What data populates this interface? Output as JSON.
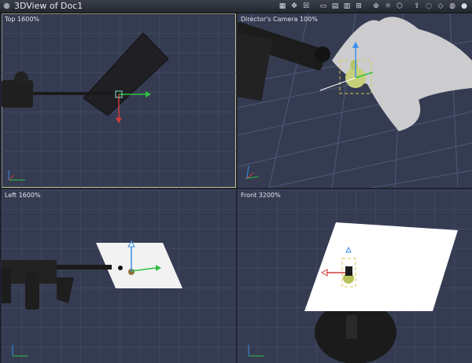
{
  "window": {
    "title": "3DView of Doc1"
  },
  "toolbar": {
    "icons": [
      "grid-icon",
      "camera-fit-icon",
      "wireframe-icon",
      "layout-1-icon",
      "layout-2-icon",
      "layout-3-icon",
      "layout-4-icon",
      "gizmo-icon",
      "light-icon",
      "bounding-box-icon",
      "axis-icon",
      "sphere-icon",
      "cube-icon",
      "shade-icon",
      "material-icon"
    ]
  },
  "viewports": {
    "top": {
      "label": "Top 1600%"
    },
    "camera": {
      "label": "Director's Camera 100%"
    },
    "left": {
      "label": "Left 1600%"
    },
    "front": {
      "label": "Front 3200%"
    }
  },
  "colors": {
    "viewport_bg": "#353c52",
    "grid_line": "#4a5270",
    "active_border": "#c9c28a",
    "axis_x": "#d23b3b",
    "axis_y": "#2fbf3f",
    "axis_z": "#3a8fe8"
  }
}
